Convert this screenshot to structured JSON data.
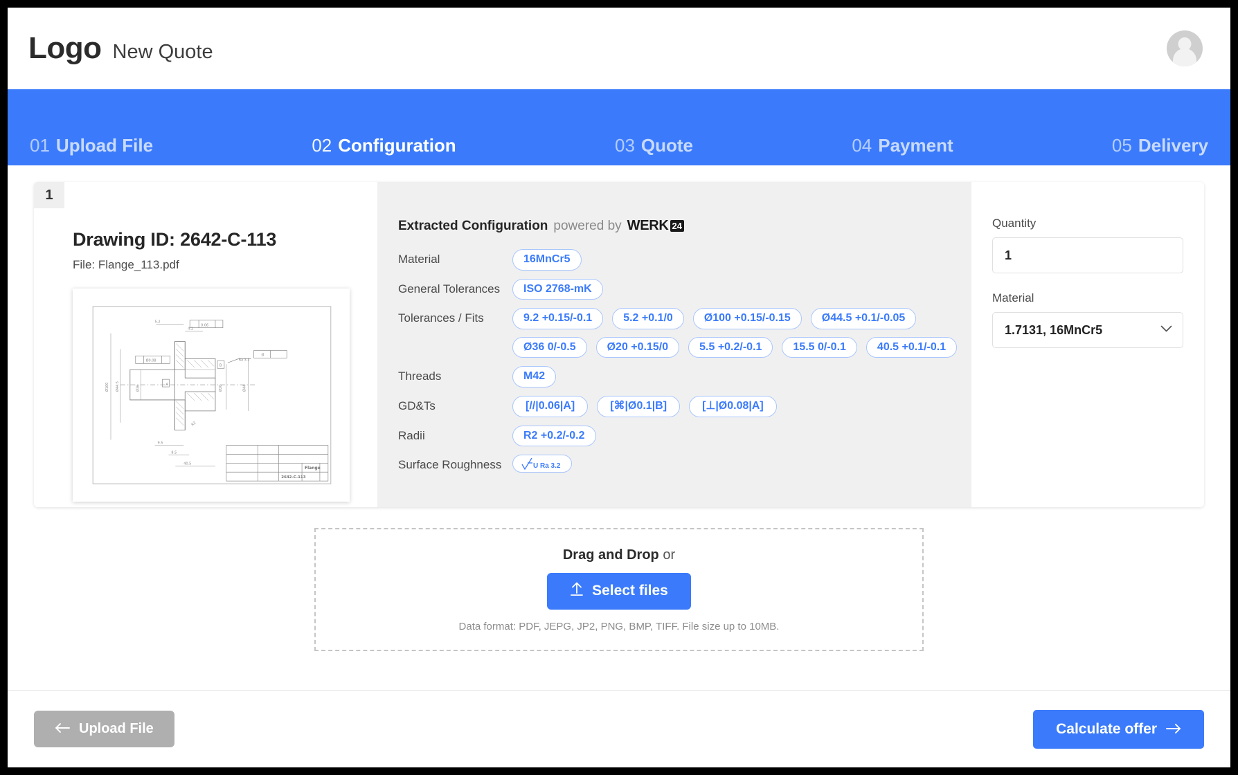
{
  "header": {
    "logo": "Logo",
    "subtitle": "New Quote",
    "avatar_icon": "user-avatar-icon"
  },
  "stepper": {
    "active_index": 1,
    "steps": [
      {
        "num": "01",
        "label": "Upload File"
      },
      {
        "num": "02",
        "label": "Configuration"
      },
      {
        "num": "03",
        "label": "Quote"
      },
      {
        "num": "04",
        "label": "Payment"
      },
      {
        "num": "05",
        "label": "Delivery"
      }
    ],
    "accent_color": "#3b7bfb"
  },
  "part_card": {
    "index": "1",
    "drawing_title": "Drawing ID: 2642-C-113",
    "file_label": "File: Flange_113.pdf",
    "thumbnail_icon": "technical-drawing-thumbnail",
    "drawing": {
      "part_name": "Flange",
      "part_number": "2642-C-113"
    },
    "config": {
      "heading_bold": "Extracted Configuration",
      "heading_rest": "powered by",
      "provider": "WERK",
      "provider_badge": "24",
      "rows": [
        {
          "label": "Material",
          "values": [
            "16MnCr5"
          ]
        },
        {
          "label": "General Tolerances",
          "values": [
            "ISO 2768-mK"
          ]
        },
        {
          "label": "Tolerances / Fits",
          "values": [
            "9.2 +0.15/-0.1",
            "5.2 +0.1/0",
            "Ø100 +0.15/-0.15",
            "Ø44.5 +0.1/-0.05",
            "Ø36 0/-0.5",
            "Ø20 +0.15/0",
            "5.5 +0.2/-0.1",
            "15.5 0/-0.1",
            "40.5 +0.1/-0.1"
          ]
        },
        {
          "label": "Threads",
          "values": [
            "M42"
          ]
        },
        {
          "label": "GD&Ts",
          "values": [
            "[//|0.06|A]",
            "[⌘|Ø0.1|B]",
            "[⊥|Ø0.08|A]"
          ]
        },
        {
          "label": "Radii",
          "values": [
            "R2 +0.2/-0.2"
          ]
        },
        {
          "label": "Surface Roughness",
          "values": [
            "U Ra 3.2"
          ],
          "is_roughness": true
        }
      ]
    },
    "sidebar": {
      "quantity_label": "Quantity",
      "quantity_value": "1",
      "material_label": "Material",
      "material_value": "1.7131, 16MnCr5",
      "dropdown_icon": "chevron-down-icon"
    }
  },
  "dropzone": {
    "title_bold": "Drag and Drop",
    "title_rest": "or",
    "button_label": "Select files",
    "button_icon": "upload-icon",
    "note": "Data format: PDF, JEPG, JP2, PNG, BMP, TIFF. File size up to 10MB."
  },
  "footer": {
    "back_label": "Upload File",
    "back_icon": "arrow-left-icon",
    "next_label": "Calculate offer",
    "next_icon": "arrow-right-icon"
  }
}
